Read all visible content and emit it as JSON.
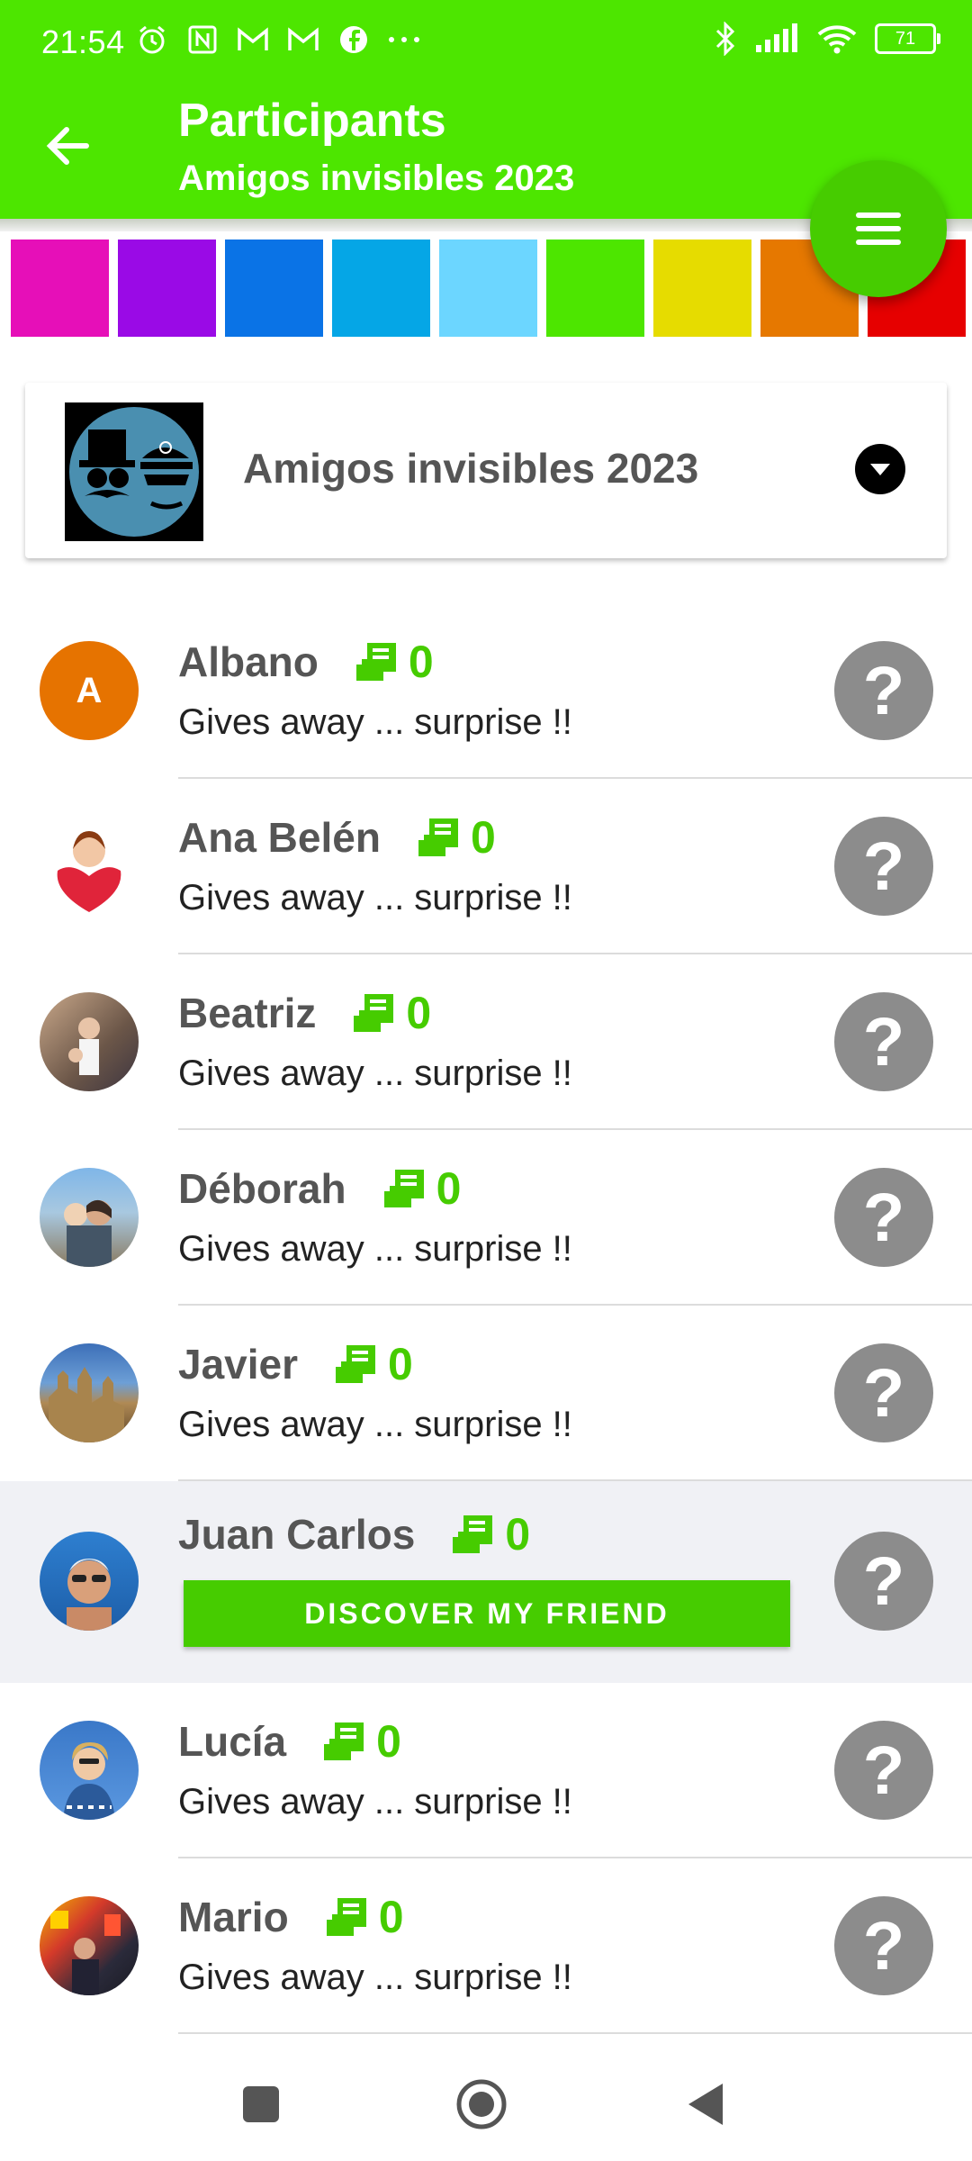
{
  "status": {
    "time": "21:54",
    "battery": "71",
    "left_icons": [
      "alarm-icon",
      "nfc-icon",
      "gmail-icon",
      "gmail-icon",
      "facebook-icon",
      "more-icon"
    ],
    "right_icons": [
      "bluetooth-icon",
      "signal-icon",
      "wifi-icon",
      "battery-icon"
    ]
  },
  "header": {
    "title": "Participants",
    "subtitle": "Amigos invisibles 2023",
    "back_icon": "arrow-left-icon",
    "menu_icon": "menu-icon"
  },
  "colors": [
    "#e60fb8",
    "#9a0ae6",
    "#0a73e6",
    "#05a6e6",
    "#6cd6ff",
    "#4de600",
    "#e6dc00",
    "#e67800",
    "#e60000"
  ],
  "group": {
    "name": "Amigos invisibles 2023",
    "dropdown_icon": "chevron-down-icon"
  },
  "participants": [
    {
      "name": "Albano",
      "gifts": "0",
      "status": "Gives away ... surprise !!",
      "initial": "A",
      "avatar_color": "#e67300",
      "help": "?"
    },
    {
      "name": "Ana Belén",
      "gifts": "0",
      "status": "Gives away ... surprise !!",
      "help": "?"
    },
    {
      "name": "Beatriz",
      "gifts": "0",
      "status": "Gives away ... surprise !!",
      "help": "?"
    },
    {
      "name": "Déborah",
      "gifts": "0",
      "status": "Gives away ... surprise !!",
      "help": "?"
    },
    {
      "name": "Javier",
      "gifts": "0",
      "status": "Gives away ... surprise !!",
      "help": "?"
    },
    {
      "name": "Juan Carlos",
      "gifts": "0",
      "action": "DISCOVER MY FRIEND",
      "help": "?"
    },
    {
      "name": "Lucía",
      "gifts": "0",
      "status": "Gives away ... surprise !!",
      "help": "?"
    },
    {
      "name": "Mario",
      "gifts": "0",
      "status": "Gives away ... surprise !!",
      "help": "?"
    }
  ],
  "navbar": [
    "recents-square-icon",
    "home-circle-icon",
    "back-triangle-icon"
  ]
}
